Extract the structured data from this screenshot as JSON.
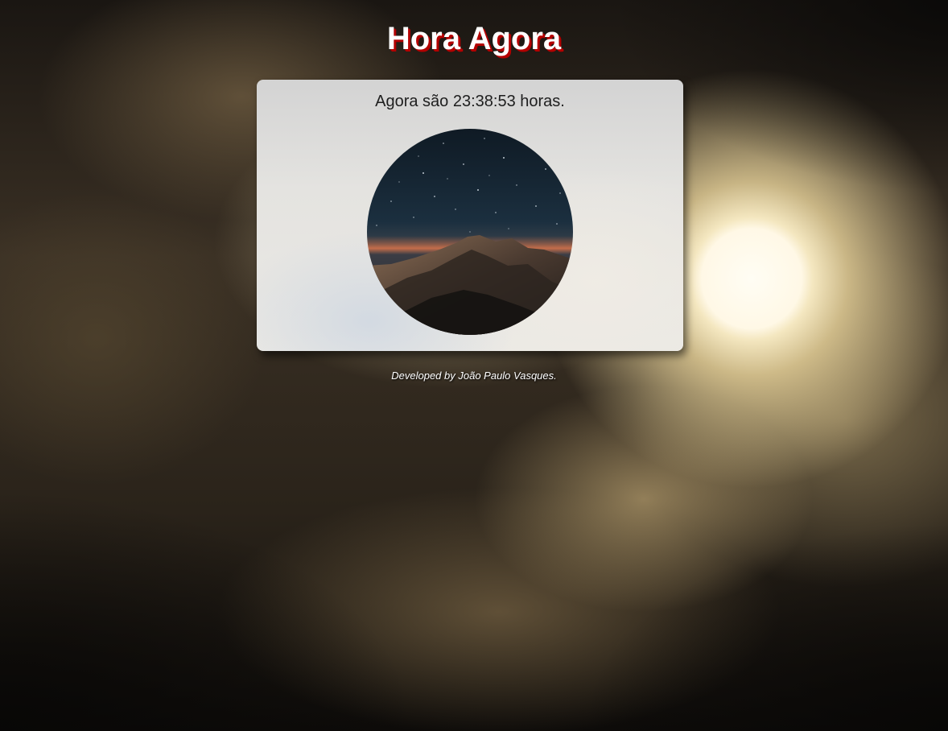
{
  "header": {
    "title": "Hora Agora"
  },
  "clock": {
    "message": "Agora são 23:38:53 horas."
  },
  "image": {
    "icon": "night-mountain-image"
  },
  "footer": {
    "credit": "Developed by João Paulo Vasques."
  },
  "colors": {
    "title_text": "#ffffff",
    "title_shadow": "#b30000",
    "card_background": "#e4e3e0"
  }
}
